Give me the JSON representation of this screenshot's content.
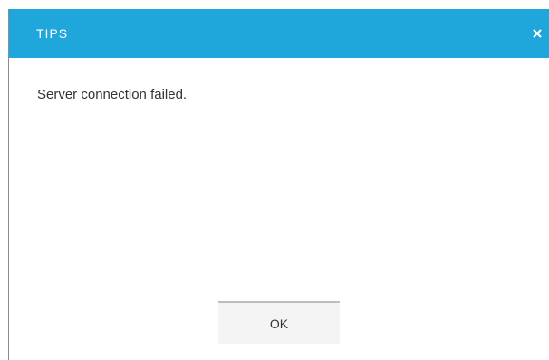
{
  "dialog": {
    "title": "TIPS",
    "message": "Server connection failed.",
    "ok_label": "OK",
    "close_icon": "close-icon"
  },
  "colors": {
    "title_bar": "#1fa7db",
    "title_text": "#ffffff",
    "button_bg": "#f4f4f4",
    "button_border": "#bdbdbd"
  }
}
